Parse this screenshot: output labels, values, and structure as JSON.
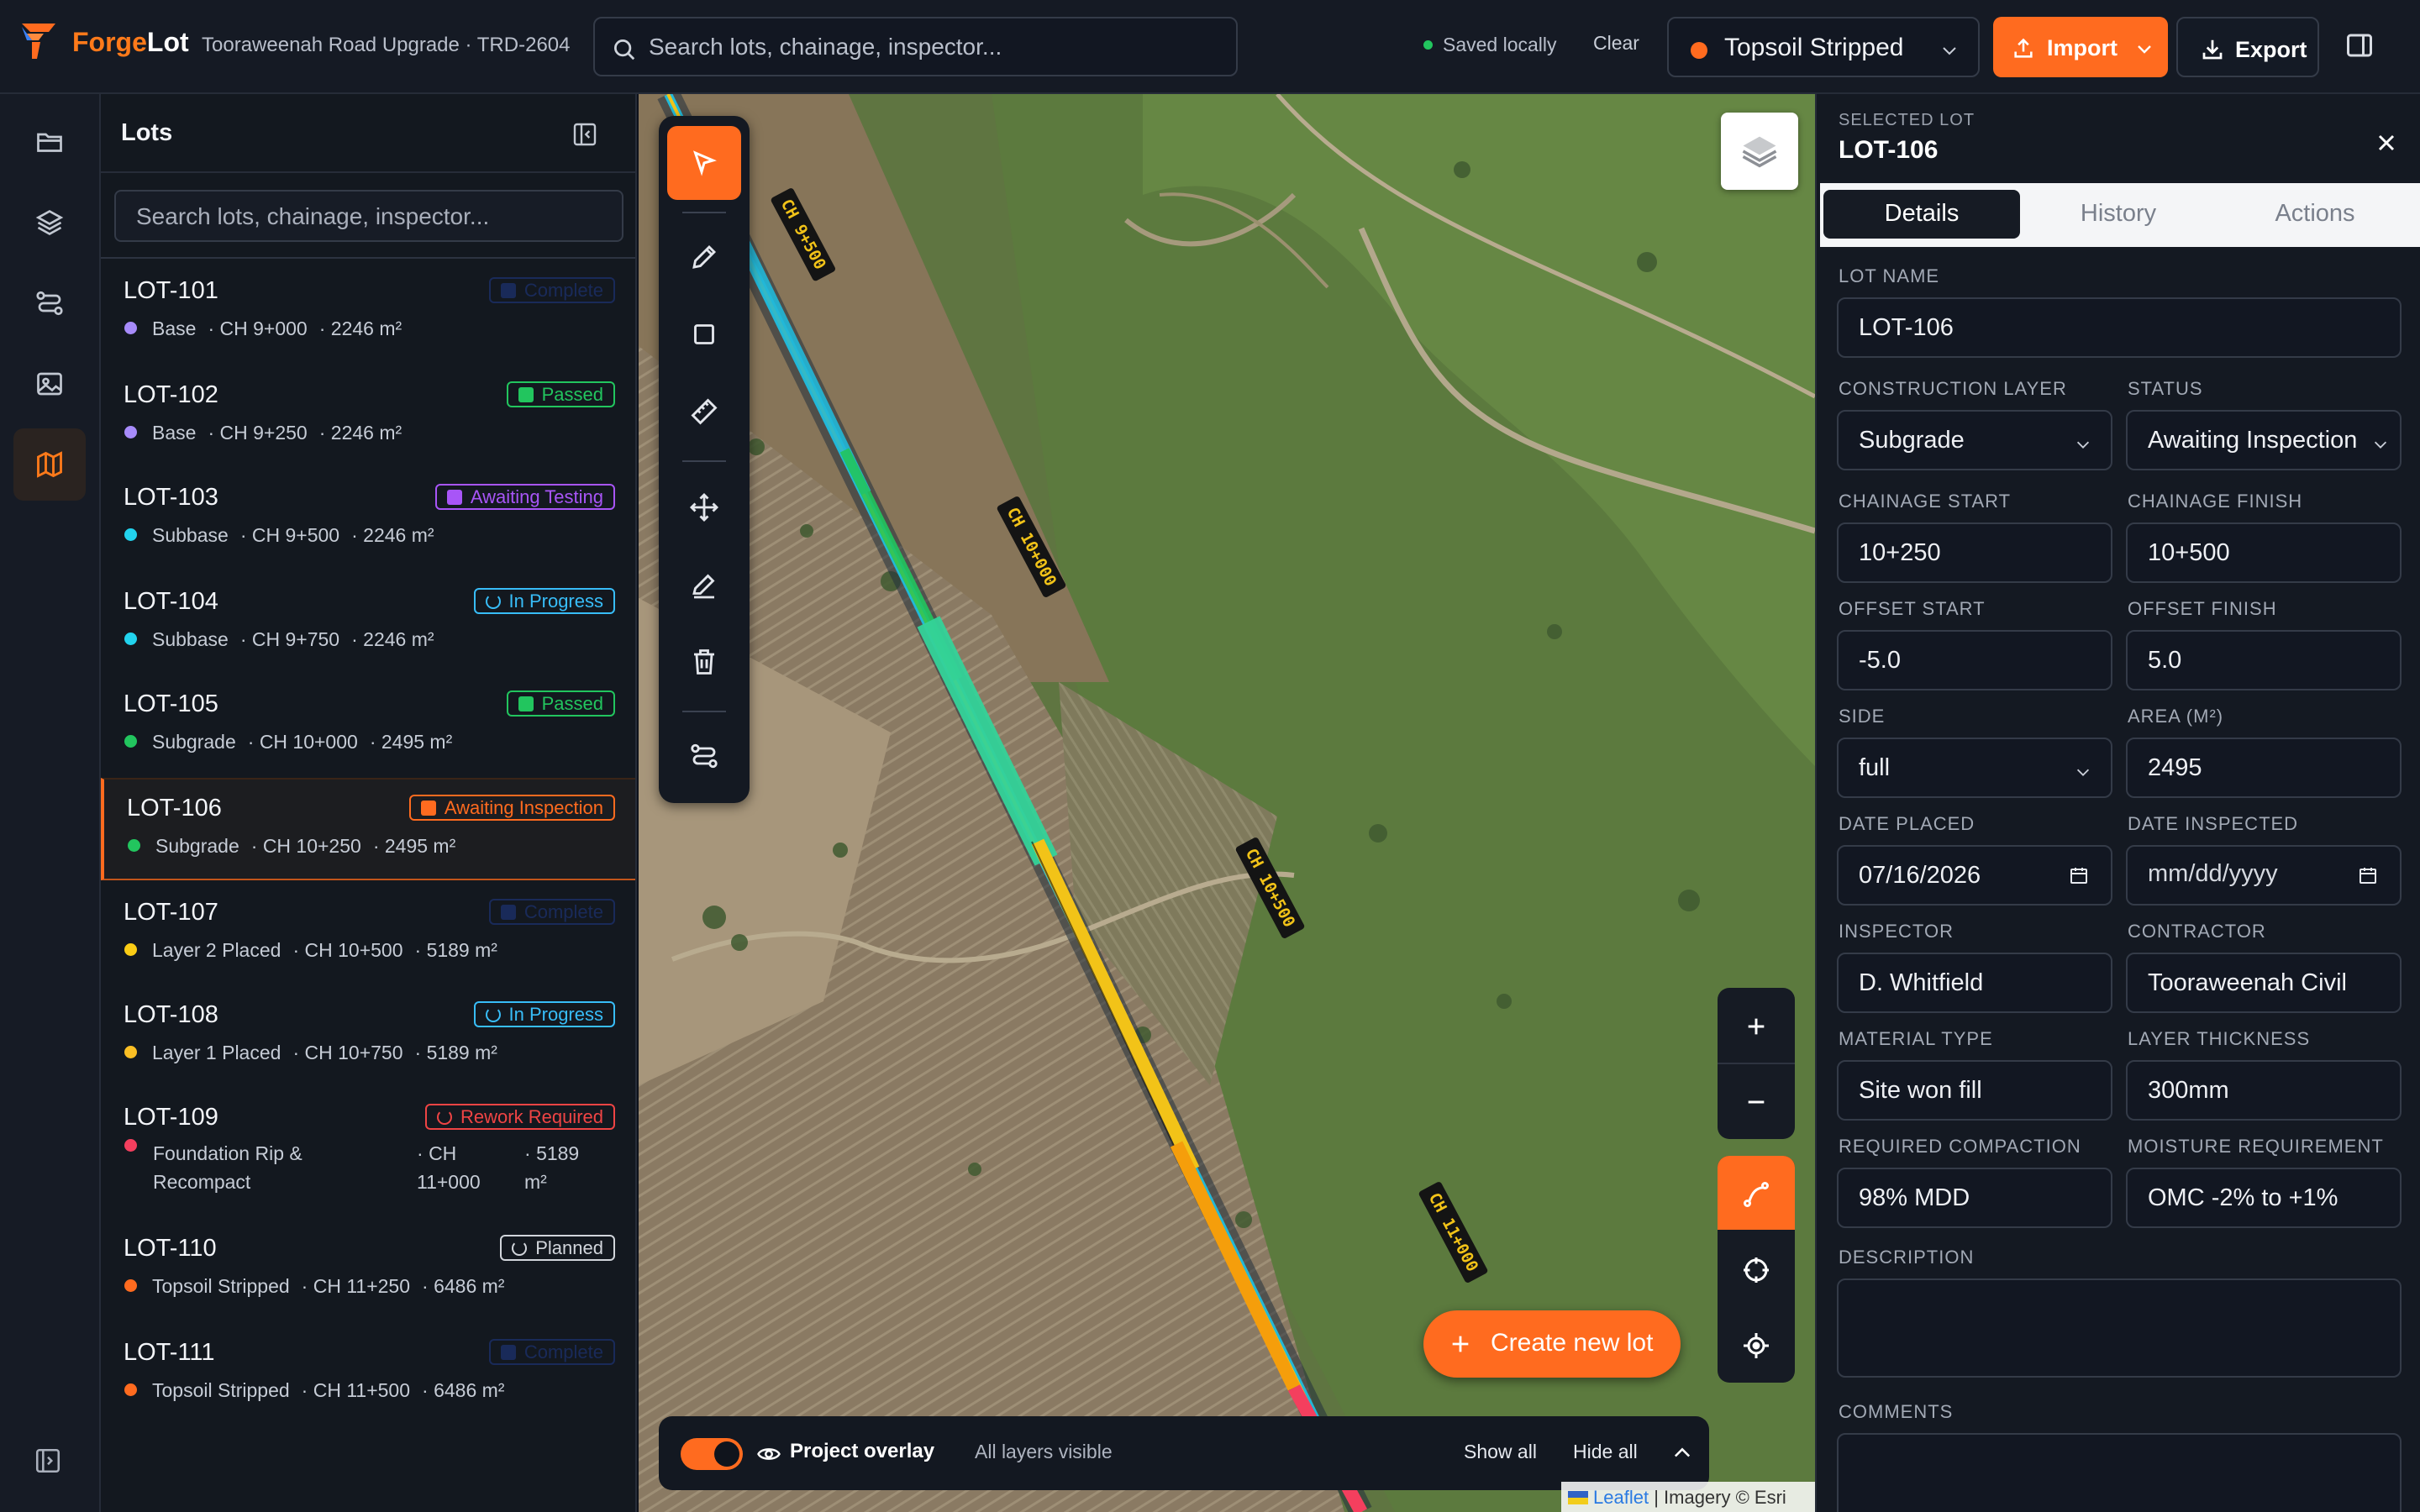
{
  "app": {
    "name_part1": "Forge",
    "name_part2": "Lot",
    "project": "Tooraweenah Road Upgrade · TRD-2604"
  },
  "header": {
    "search_placeholder": "Search lots, chainage, inspector...",
    "saved_status": "Saved locally",
    "clear_label": "Clear",
    "layer_selected": "Topsoil Stripped",
    "layer_color": "#ff6b1f",
    "import_label": "Import",
    "export_label": "Export"
  },
  "rail": {
    "items": [
      "folder-icon",
      "layers-icon",
      "route-icon",
      "image-icon",
      "map-icon"
    ],
    "active": "map-icon"
  },
  "lots_panel": {
    "title": "Lots",
    "search_placeholder": "Search lots, chainage, inspector...",
    "items": [
      {
        "id": "LOT-101",
        "layer": "Base",
        "chainage": "CH 9+000",
        "area": "2246 m²",
        "dot": "#a78bfa",
        "status": "Complete",
        "status_color": "#1f3a8a",
        "faded": true
      },
      {
        "id": "LOT-102",
        "layer": "Base",
        "chainage": "CH 9+250",
        "area": "2246 m²",
        "dot": "#a78bfa",
        "status": "Passed",
        "status_color": "#22c55e"
      },
      {
        "id": "LOT-103",
        "layer": "Subbase",
        "chainage": "CH 9+500",
        "area": "2246 m²",
        "dot": "#22d3ee",
        "status": "Awaiting Testing",
        "status_color": "#a855f7"
      },
      {
        "id": "LOT-104",
        "layer": "Subbase",
        "chainage": "CH 9+750",
        "area": "2246 m²",
        "dot": "#22d3ee",
        "status": "In Progress",
        "status_color": "#38bdf8"
      },
      {
        "id": "LOT-105",
        "layer": "Subgrade",
        "chainage": "CH 10+000",
        "area": "2495 m²",
        "dot": "#22c55e",
        "status": "Passed",
        "status_color": "#22c55e"
      },
      {
        "id": "LOT-106",
        "layer": "Subgrade",
        "chainage": "CH 10+250",
        "area": "2495 m²",
        "dot": "#22c55e",
        "status": "Awaiting Inspection",
        "status_color": "#ff6b1f",
        "selected": true
      },
      {
        "id": "LOT-107",
        "layer": "Layer 2 Placed",
        "chainage": "CH 10+500",
        "area": "5189 m²",
        "dot": "#facc15",
        "status": "Complete",
        "status_color": "#1f3a8a",
        "faded": true
      },
      {
        "id": "LOT-108",
        "layer": "Layer 1 Placed",
        "chainage": "CH 10+750",
        "area": "5189 m²",
        "dot": "#fbbf24",
        "status": "In Progress",
        "status_color": "#38bdf8"
      },
      {
        "id": "LOT-109",
        "layer": "Foundation Rip & Recompact",
        "chainage": "CH 11+000",
        "area": "5189 m²",
        "dot": "#f43f5e",
        "status": "Rework Required",
        "status_color": "#ef4444"
      },
      {
        "id": "LOT-110",
        "layer": "Topsoil Stripped",
        "chainage": "CH 11+250",
        "area": "6486 m²",
        "dot": "#ff6b1f",
        "status": "Planned",
        "status_color": "#d1d5db"
      },
      {
        "id": "LOT-111",
        "layer": "Topsoil Stripped",
        "chainage": "CH 11+500",
        "area": "6486 m²",
        "dot": "#ff6b1f",
        "status": "Complete",
        "status_color": "#1f3a8a",
        "faded": true
      }
    ]
  },
  "map": {
    "chainage_labels": [
      "CH 9+500",
      "CH 10+000",
      "CH 10+500",
      "CH 11+000"
    ],
    "create_label": "Create new lot",
    "overlay": {
      "label": "Project overlay",
      "subtitle": "All layers visible",
      "show_all": "Show all",
      "hide_all": "Hide all",
      "enabled": true
    },
    "attribution": {
      "leaflet": "Leaflet",
      "rest": "| Imagery © Esri"
    }
  },
  "details": {
    "kicker": "SELECTED LOT",
    "title": "LOT-106",
    "tabs": [
      "Details",
      "History",
      "Actions"
    ],
    "active_tab": "Details",
    "labels": {
      "lot_name": "LOT NAME",
      "construction_layer": "CONSTRUCTION LAYER",
      "status": "STATUS",
      "chainage_start": "CHAINAGE START",
      "chainage_finish": "CHAINAGE FINISH",
      "offset_start": "OFFSET START",
      "offset_finish": "OFFSET FINISH",
      "side": "SIDE",
      "area": "AREA (M²)",
      "date_placed": "DATE PLACED",
      "date_inspected": "DATE INSPECTED",
      "inspector": "INSPECTOR",
      "contractor": "CONTRACTOR",
      "material_type": "MATERIAL TYPE",
      "layer_thickness": "LAYER THICKNESS",
      "required_compaction": "REQUIRED COMPACTION",
      "moisture_requirement": "MOISTURE REQUIREMENT",
      "description": "DESCRIPTION",
      "comments": "COMMENTS"
    },
    "values": {
      "lot_name": "LOT-106",
      "construction_layer": "Subgrade",
      "status": "Awaiting Inspection",
      "chainage_start": "10+250",
      "chainage_finish": "10+500",
      "offset_start": "-5.0",
      "offset_finish": "5.0",
      "side": "full",
      "area": "2495",
      "date_placed": "07/16/2026",
      "date_inspected_placeholder": "mm/dd/yyyy",
      "inspector": "D. Whitfield",
      "contractor": "Tooraweenah Civil",
      "material_type": "Site won fill",
      "layer_thickness": "300mm",
      "required_compaction": "98% MDD",
      "moisture_requirement": "OMC -2% to +1%"
    }
  }
}
